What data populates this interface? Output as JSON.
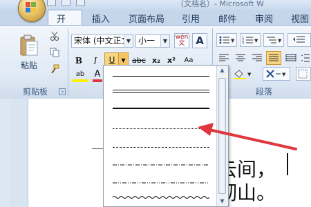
{
  "window": {
    "title": "（文档名）- Microsoft W",
    "qat_icons": [
      "save-icon",
      "undo-icon",
      "redo-icon"
    ]
  },
  "tabs": [
    {
      "label": "开始",
      "active": true
    },
    {
      "label": "插入"
    },
    {
      "label": "页面布局"
    },
    {
      "label": "引用"
    },
    {
      "label": "邮件"
    },
    {
      "label": "审阅"
    },
    {
      "label": "视图"
    }
  ],
  "clipboard": {
    "paste_label": "粘贴",
    "group_label": "剪贴板",
    "icons": [
      "cut-icon",
      "copy-icon",
      "format-painter-icon"
    ]
  },
  "font": {
    "name_value": "宋体 (中文正文)",
    "size_value": "小一",
    "phonetic_glyph": "wén 文",
    "border_glyph": "A",
    "bold": "B",
    "italic": "I",
    "underline": "U",
    "strike": "abc",
    "subscript": "x₂",
    "superscript": "x²",
    "highlight": "ab",
    "font_color": "A",
    "aa": "Aa"
  },
  "paragraph": {
    "group_label": "段落"
  },
  "underline_menu": {
    "styles": [
      "single",
      "double",
      "thick",
      "dotted",
      "dashed",
      "dash-dot",
      "dash-dot-dot",
      "wave"
    ],
    "selected_index": 3
  },
  "document": {
    "line1": "云间，",
    "line2": "彻山。"
  },
  "colors": {
    "accent": "#e0373e",
    "ribbon": "#dfe9f5",
    "tab_text": "#1e395b"
  }
}
